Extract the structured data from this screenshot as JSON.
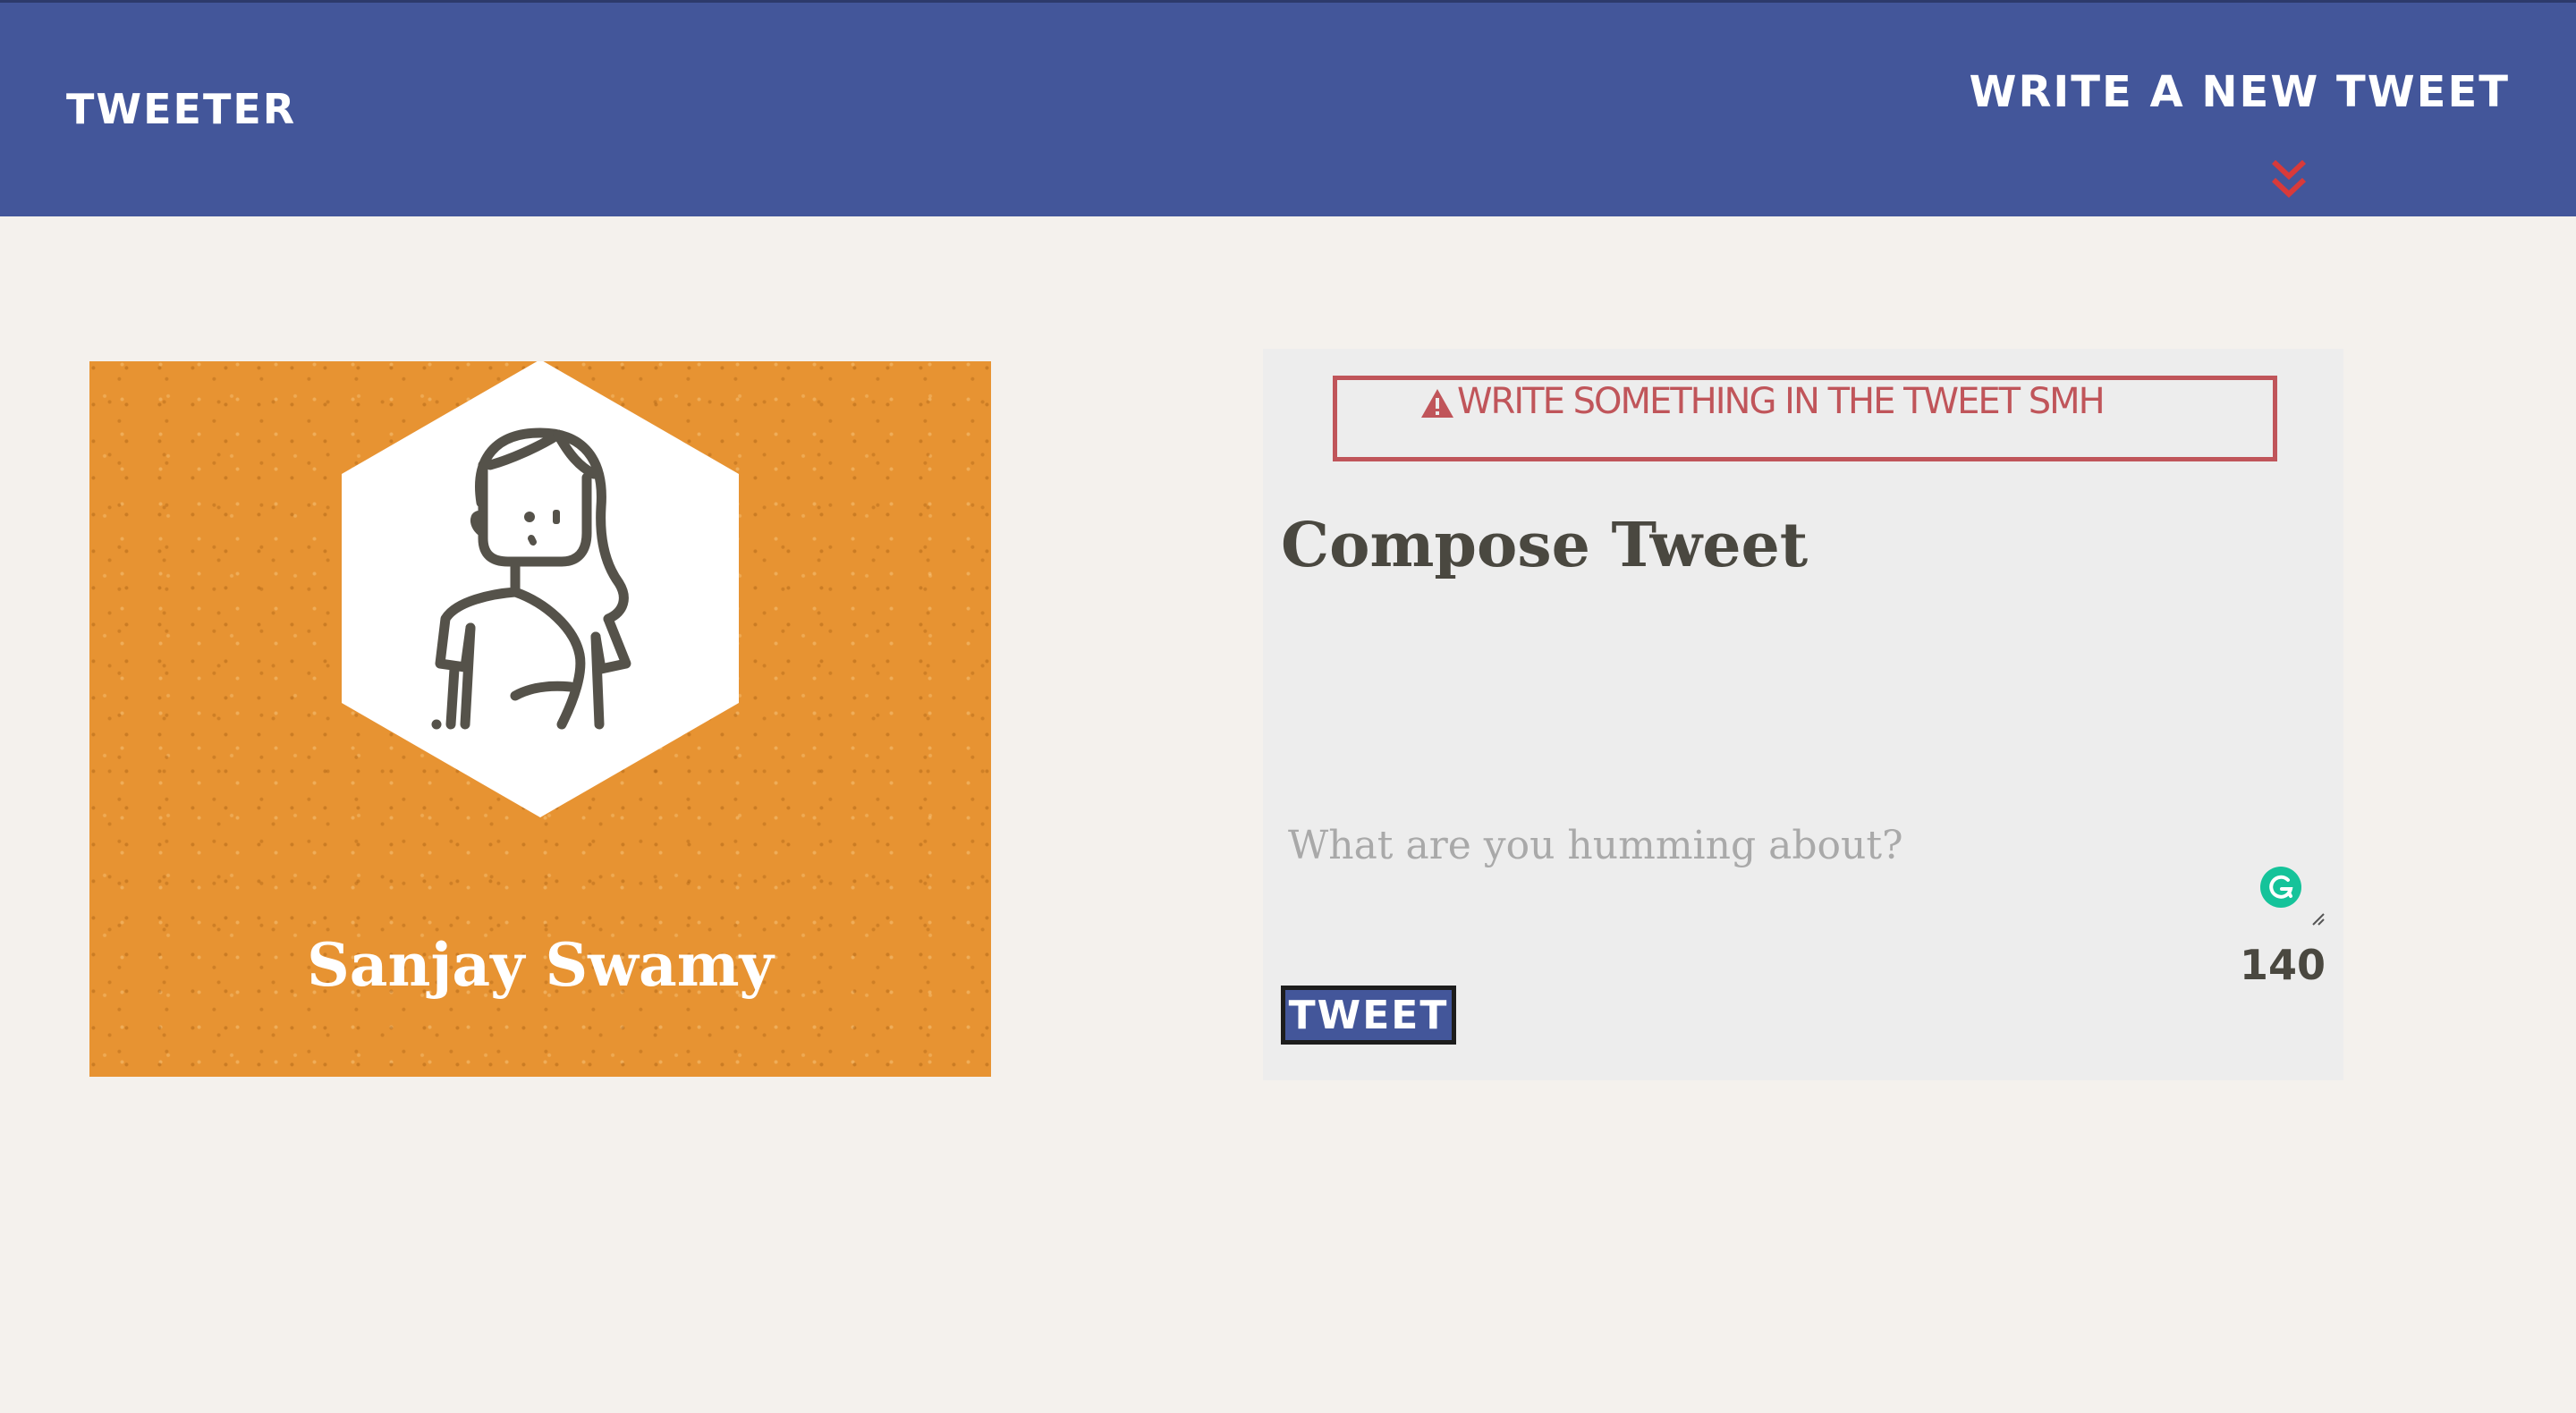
{
  "navbar": {
    "brand": "Tweeter",
    "compose_toggle_label": "Write a new tweet",
    "toggle_icon": "chevron-double-down-icon"
  },
  "profile": {
    "name": "Sanjay Swamy",
    "avatar_icon": "avatar-icon",
    "card_color": "#e79332"
  },
  "compose": {
    "error_icon": "warning-icon",
    "error_message": "Write something in the tweet smh",
    "title": "Compose Tweet",
    "textarea_value": "",
    "textarea_placeholder": "What are you humming about?",
    "char_counter": "140",
    "submit_label": "Tweet",
    "grammarly_icon": "grammarly-icon"
  },
  "colors": {
    "navbar": "#43569a",
    "accent_red": "#c0555a",
    "background": "#f4f1ed",
    "panel": "#ededed",
    "chevron": "#d83a3a"
  }
}
